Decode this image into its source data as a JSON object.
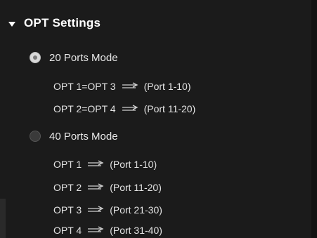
{
  "section": {
    "title": "OPT Settings"
  },
  "modes": [
    {
      "label": "20 Ports Mode",
      "selected": true,
      "mappings": [
        {
          "opt": "OPT 1=OPT 3",
          "ports": "(Port 1-10)"
        },
        {
          "opt": "OPT 2=OPT 4",
          "ports": "(Port 11-20)"
        }
      ]
    },
    {
      "label": "40 Ports Mode",
      "selected": false,
      "mappings": [
        {
          "opt": "OPT 1",
          "ports": "(Port 1-10)"
        },
        {
          "opt": "OPT 2",
          "ports": "(Port 11-20)"
        },
        {
          "opt": "OPT 3",
          "ports": "(Port 21-30)"
        },
        {
          "opt": "OPT 4",
          "ports": "(Port 31-40)"
        }
      ]
    }
  ],
  "icons": {
    "caret": "caret-down-icon",
    "arrow": "right-arrows-icon"
  },
  "colors": {
    "background": "#1b1b1b",
    "text": "#e6e6e6",
    "title": "#ffffff"
  }
}
